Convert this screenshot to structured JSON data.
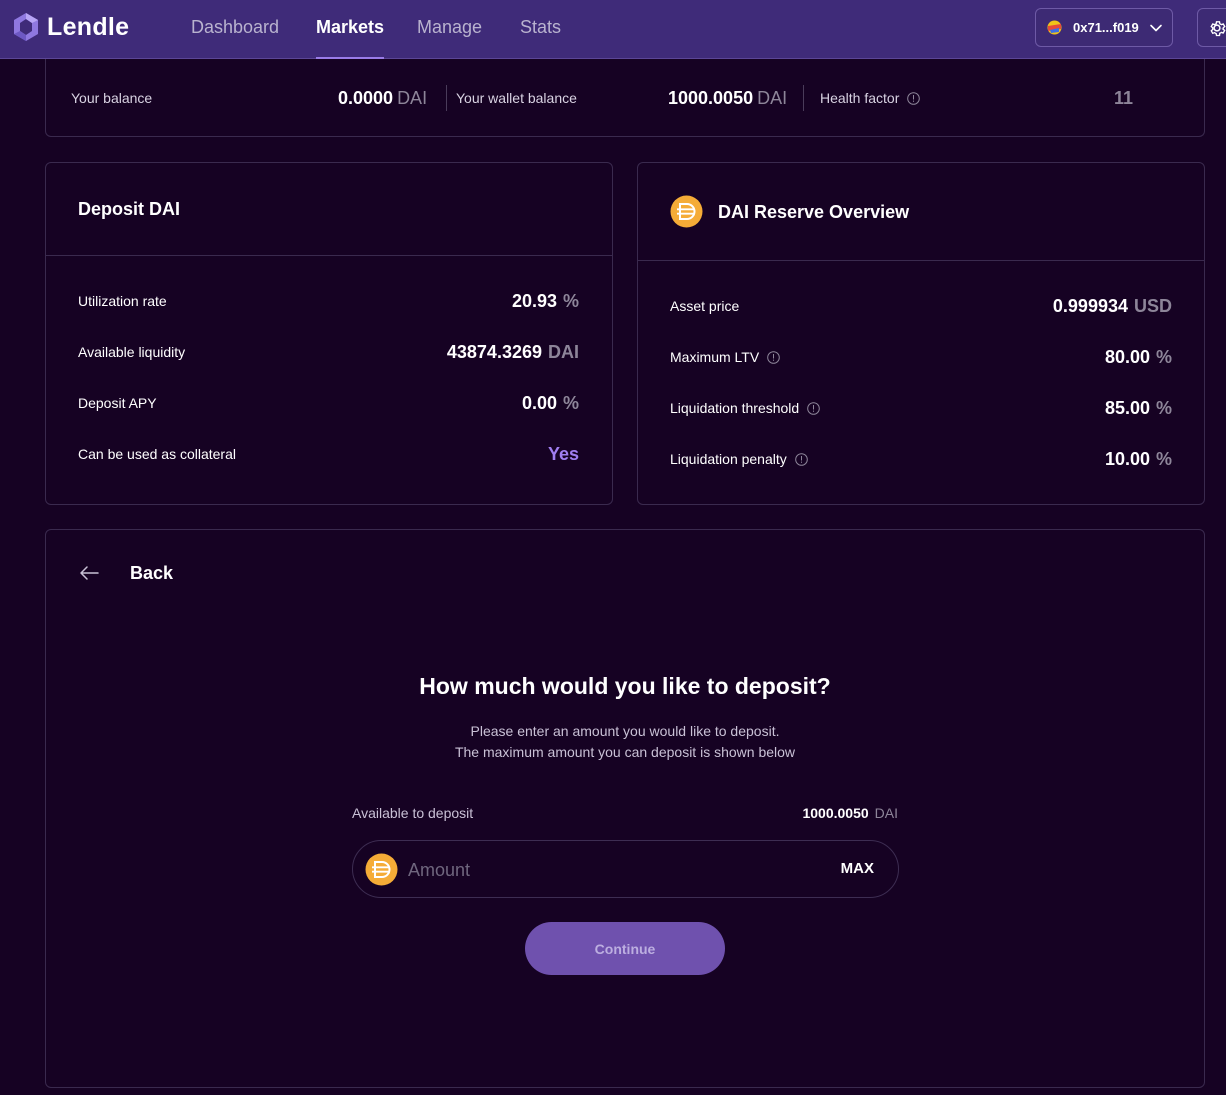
{
  "brand": {
    "name": "Lendle"
  },
  "nav": [
    {
      "label": "Dashboard",
      "active": false
    },
    {
      "label": "Markets",
      "active": true
    },
    {
      "label": "Manage",
      "active": false
    },
    {
      "label": "Stats",
      "active": false
    }
  ],
  "wallet": {
    "address": "0x71...f019"
  },
  "balances": {
    "your_balance_label": "Your balance",
    "your_balance_value": "0.0000",
    "your_balance_unit": "DAI",
    "wallet_balance_label": "Your wallet balance",
    "wallet_balance_value": "1000.0050",
    "wallet_balance_unit": "DAI",
    "health_factor_label": "Health factor",
    "health_factor_value": "11"
  },
  "deposit_card": {
    "title": "Deposit DAI",
    "rows": [
      {
        "label": "Utilization rate",
        "value": "20.93",
        "unit": "%"
      },
      {
        "label": "Available liquidity",
        "value": "43874.3269",
        "unit": "DAI"
      },
      {
        "label": "Deposit APY",
        "value": "0.00",
        "unit": "%"
      },
      {
        "label": "Can be used as collateral",
        "value": "Yes",
        "unit": ""
      }
    ]
  },
  "reserve_card": {
    "title": "DAI Reserve Overview",
    "rows": [
      {
        "label": "Asset price",
        "value": "0.999934",
        "unit": "USD"
      },
      {
        "label": "Maximum LTV",
        "value": "80.00",
        "unit": "%"
      },
      {
        "label": "Liquidation threshold",
        "value": "85.00",
        "unit": "%"
      },
      {
        "label": "Liquidation penalty",
        "value": "10.00",
        "unit": "%"
      }
    ]
  },
  "deposit_form": {
    "back_label": "Back",
    "heading": "How much would you like to deposit?",
    "subtitle_line1": "Please enter an amount you would like to deposit.",
    "subtitle_line2": "The maximum amount you can deposit is shown below",
    "available_label": "Available to deposit",
    "available_value": "1000.0050",
    "available_unit": "DAI",
    "amount_placeholder": "Amount",
    "amount_value": "",
    "max_label": "MAX",
    "continue_label": "Continue"
  },
  "colors": {
    "background": "#160223",
    "topbar": "#3f2b79",
    "accent": "#a07ef0",
    "button": "#6f51ae",
    "dai_coin": "#f5ac37"
  },
  "icons": [
    "lendle-logo-icon",
    "wallet-avatar-icon",
    "chevron-down-icon",
    "gear-icon",
    "info-icon",
    "dai-coin-icon",
    "arrow-left-icon"
  ]
}
